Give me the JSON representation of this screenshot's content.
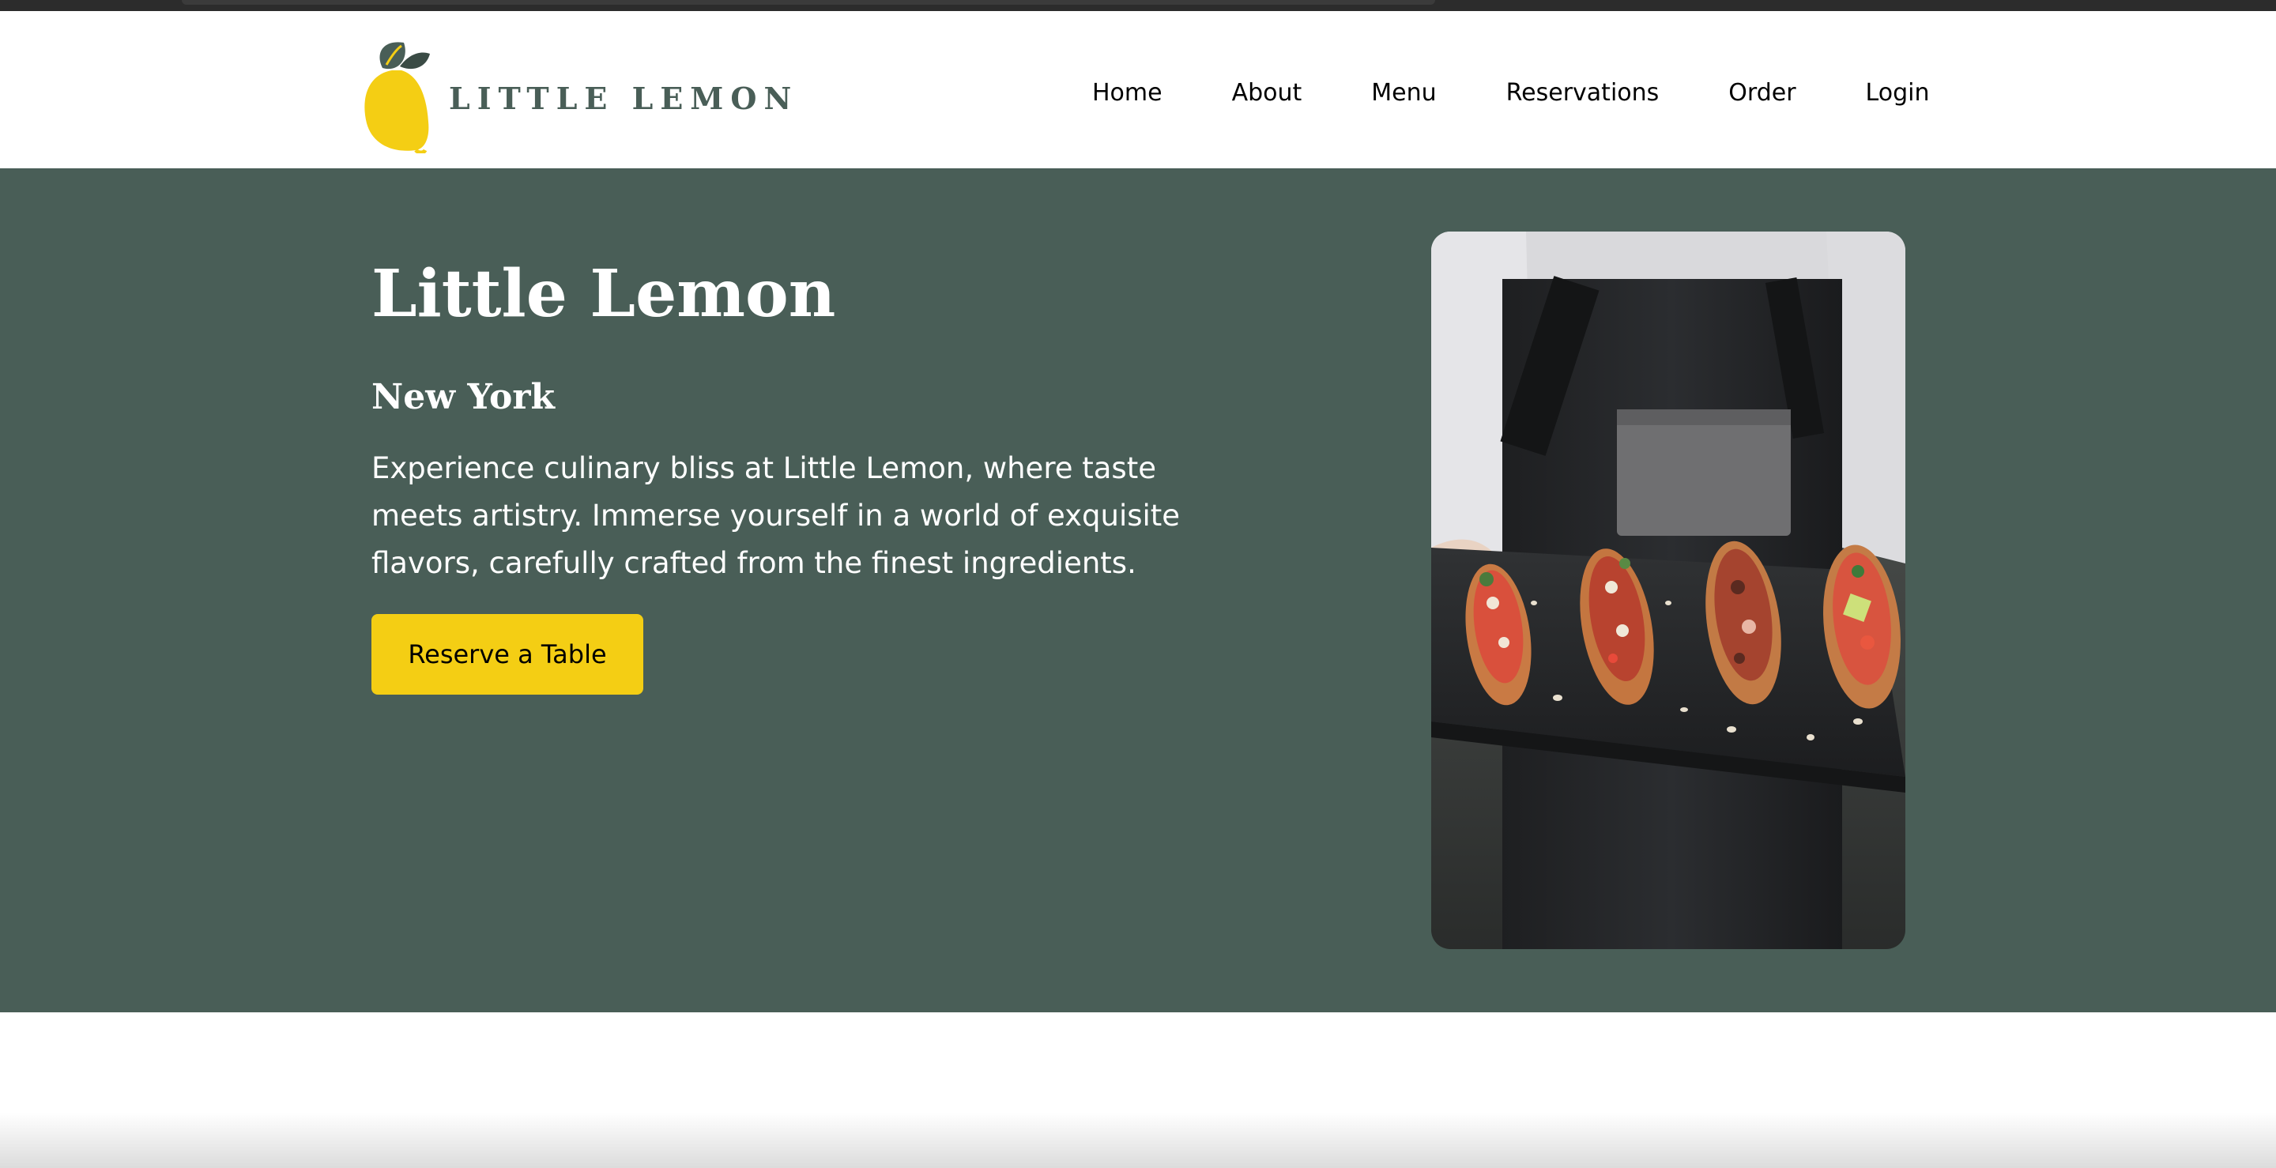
{
  "brand": {
    "logo_text": "LITTLE LEMON",
    "logo_icon": "lemon-icon",
    "primary_color": "#495e57",
    "accent_color": "#f4ce14"
  },
  "nav": {
    "items": [
      {
        "label": "Home"
      },
      {
        "label": "About"
      },
      {
        "label": "Menu"
      },
      {
        "label": "Reservations"
      },
      {
        "label": "Order"
      },
      {
        "label": "Login"
      }
    ]
  },
  "hero": {
    "title": "Little Lemon",
    "subtitle": "New York",
    "description": "Experience culinary bliss at Little Lemon, where taste meets artistry. Immerse yourself in a world of exquisite flavors, carefully crafted from the finest ingredients.",
    "cta_label": "Reserve a Table",
    "image_subject": "chef holding slate tray of bruschetta"
  }
}
